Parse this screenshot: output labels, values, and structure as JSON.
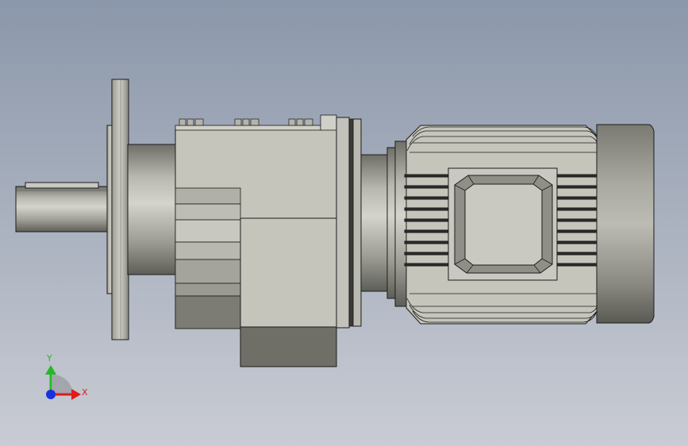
{
  "viewport": {
    "background_top": "#8b97aa",
    "background_bottom": "#c9ccd4"
  },
  "model": {
    "body_color": "#c5c5bc",
    "dark_color": "#77776f",
    "edge_color": "#1c1c1c"
  },
  "triad": {
    "x_label": "X",
    "y_label": "Y",
    "x_color": "#e11a1a",
    "y_color": "#25b825",
    "z_color": "#1a2fe0"
  }
}
